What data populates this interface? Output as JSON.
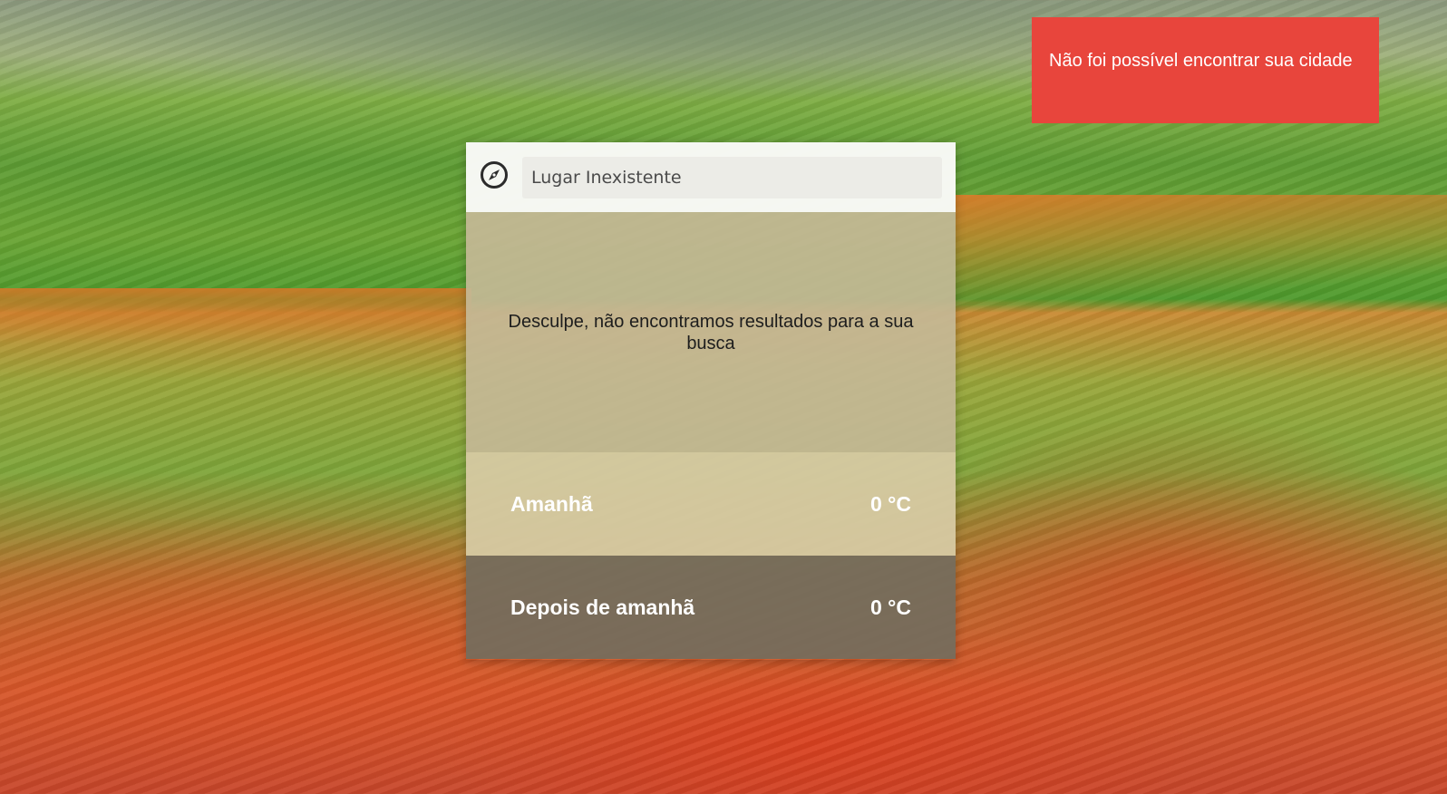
{
  "notification": {
    "message": "Não foi possível encontrar sua cidade"
  },
  "search": {
    "value": "Lugar Inexistente",
    "icon": "compass-icon"
  },
  "result": {
    "message": "Desculpe, não encontramos resultados para a sua busca"
  },
  "forecast": [
    {
      "day": "Amanhã",
      "temp": "0 °C"
    },
    {
      "day": "Depois de amanhã",
      "temp": "0 °C"
    }
  ],
  "colors": {
    "notification_bg": "#e8453c",
    "tomorrow_bg": "#d6c9a2",
    "after_bg": "#756c5c"
  }
}
